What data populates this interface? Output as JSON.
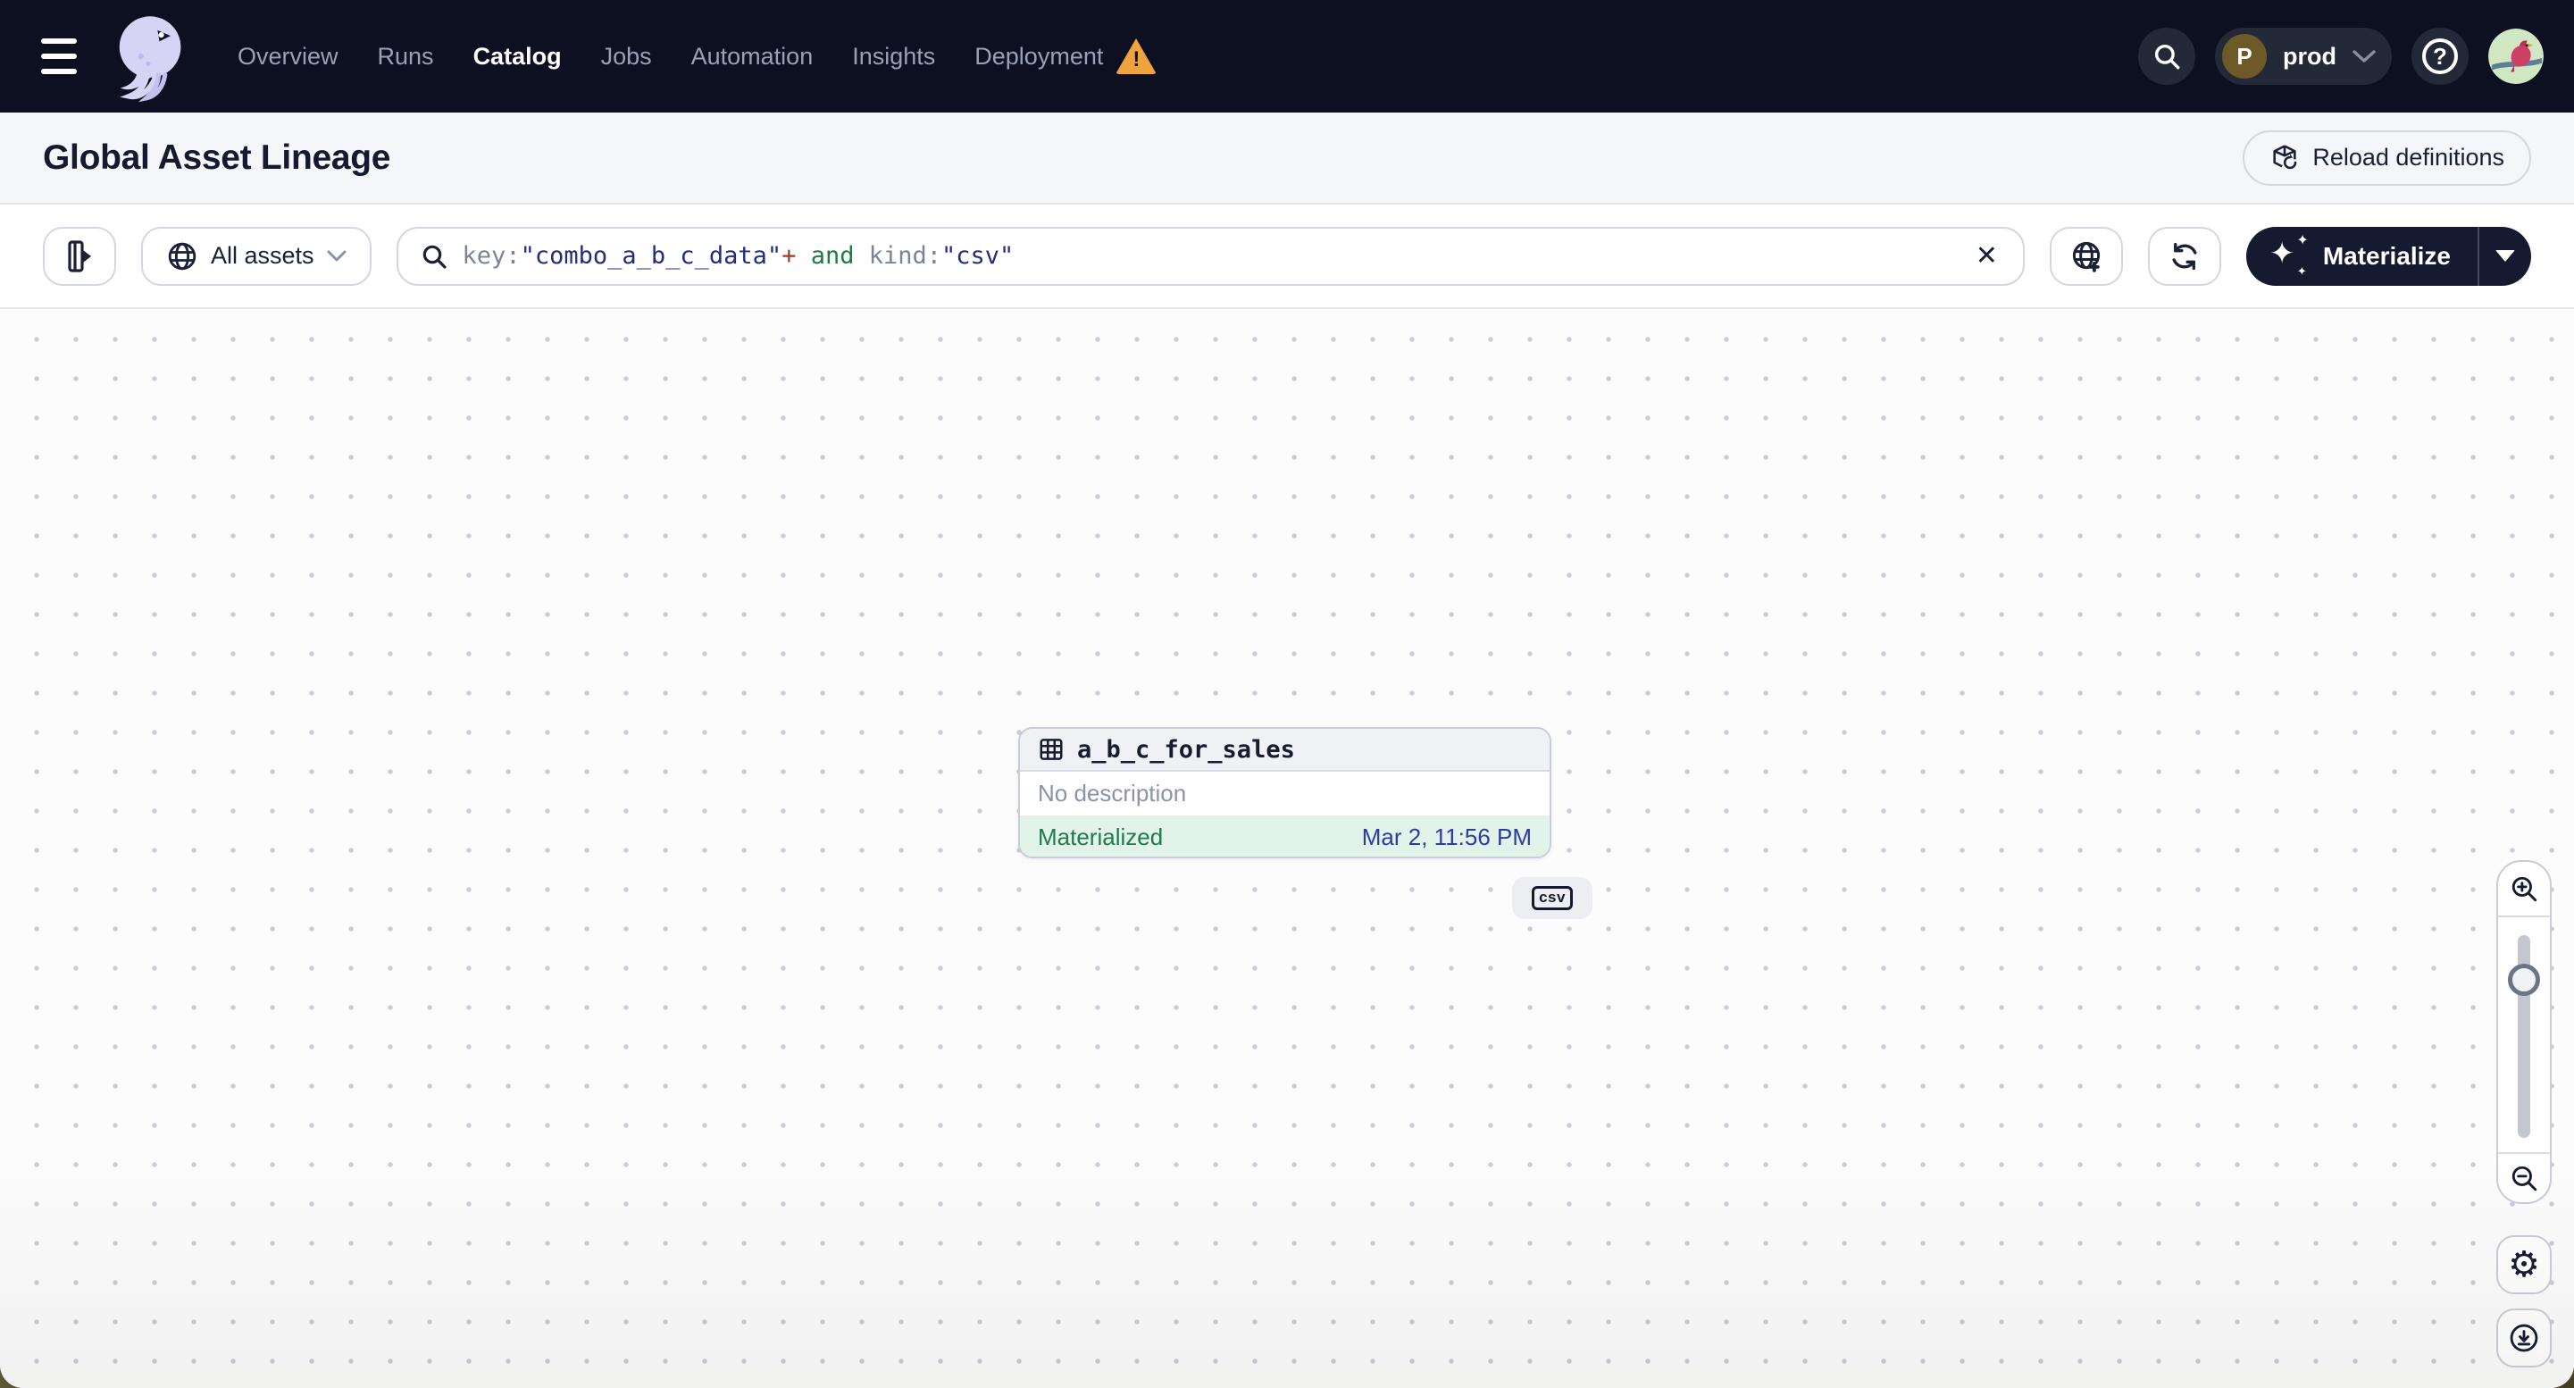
{
  "nav": {
    "items": [
      {
        "label": "Overview",
        "active": false
      },
      {
        "label": "Runs",
        "active": false
      },
      {
        "label": "Catalog",
        "active": true
      },
      {
        "label": "Jobs",
        "active": false
      },
      {
        "label": "Automation",
        "active": false
      },
      {
        "label": "Insights",
        "active": false
      },
      {
        "label": "Deployment",
        "active": false,
        "warning": true
      }
    ],
    "warning_mark": "!",
    "environment": {
      "initial": "P",
      "name": "prod"
    },
    "help_mark": "?"
  },
  "page": {
    "title": "Global Asset Lineage",
    "reload_button_label": "Reload definitions"
  },
  "toolbar": {
    "scope_label": "All assets",
    "query": {
      "key_field": "key:",
      "key_value": "\"combo_a_b_c_data\"",
      "plus_op": "+",
      "and_op": " and ",
      "kind_field": "kind:",
      "kind_value": "\"csv\""
    },
    "materialize_label": "Materialize",
    "sparkle_glyphs": {
      "big": "✦",
      "small_top": "✦",
      "small_bottom": "✦"
    },
    "clear_glyph": "✕"
  },
  "graph_node": {
    "name": "a_b_c_for_sales",
    "description": "No description",
    "status": "Materialized",
    "status_time": "Mar 2, 11:56 PM",
    "kind_badge": "csv"
  },
  "controls": {
    "gear_glyph": "⚙"
  },
  "colors": {
    "navbar_bg": "#0d1021",
    "accent_dark": "#151a30",
    "warning_orange": "#eea33e",
    "materialized_green": "#1f7a4d",
    "materialized_bg": "#e2f4e9",
    "timestamp_blue": "#2e3ba0",
    "query_value_indigo": "#232d7d",
    "query_bool_green": "#1d7d47",
    "query_op_red": "#9e3c2b"
  }
}
